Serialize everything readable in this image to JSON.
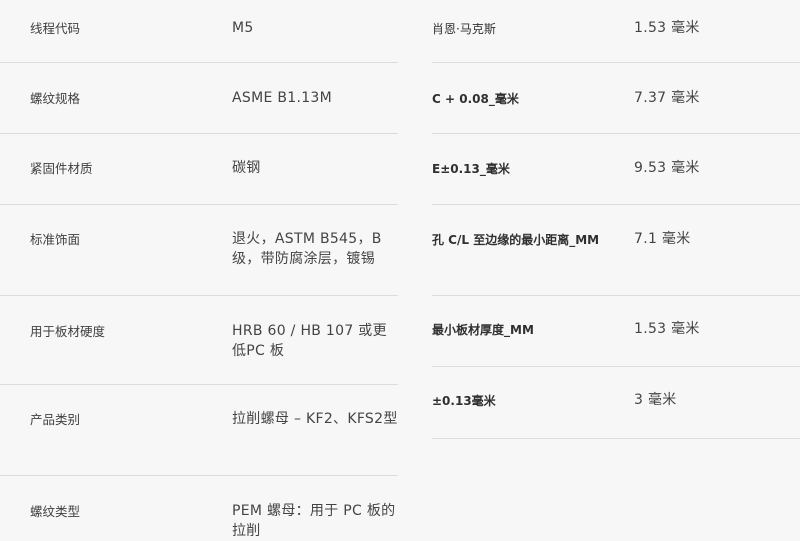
{
  "left_specs": [
    {
      "label": "线程代码",
      "value": "M5"
    },
    {
      "label": "螺纹规格",
      "value": "ASME B1.13M"
    },
    {
      "label": "紧固件材质",
      "value": "碳钢"
    },
    {
      "label": "标准饰面",
      "value": "退火，ASTM B545，B级，带防腐涂层，镀锡"
    },
    {
      "label": "用于板材硬度",
      "value": "HRB 60 / HB 107 或更低PC 板"
    },
    {
      "label": "产品类别",
      "value": "拉削螺母 – KF2、KFS2型"
    },
    {
      "label": "螺纹类型",
      "value": "PEM 螺母：用于 PC 板的拉削"
    }
  ],
  "right_specs": [
    {
      "label": "肖恩·马克斯",
      "value": "1.53 毫米"
    },
    {
      "label": "C + 0.08_毫米",
      "value": "7.37 毫米"
    },
    {
      "label": "E±0.13_毫米",
      "value": "9.53 毫米"
    },
    {
      "label": "孔 C/L 至边缘的最小距离_MM",
      "value": "7.1 毫米"
    },
    {
      "label": "最小板材厚度_MM",
      "value": "1.53 毫米"
    },
    {
      "label": "±0.13毫米",
      "value": "3 毫米"
    }
  ]
}
